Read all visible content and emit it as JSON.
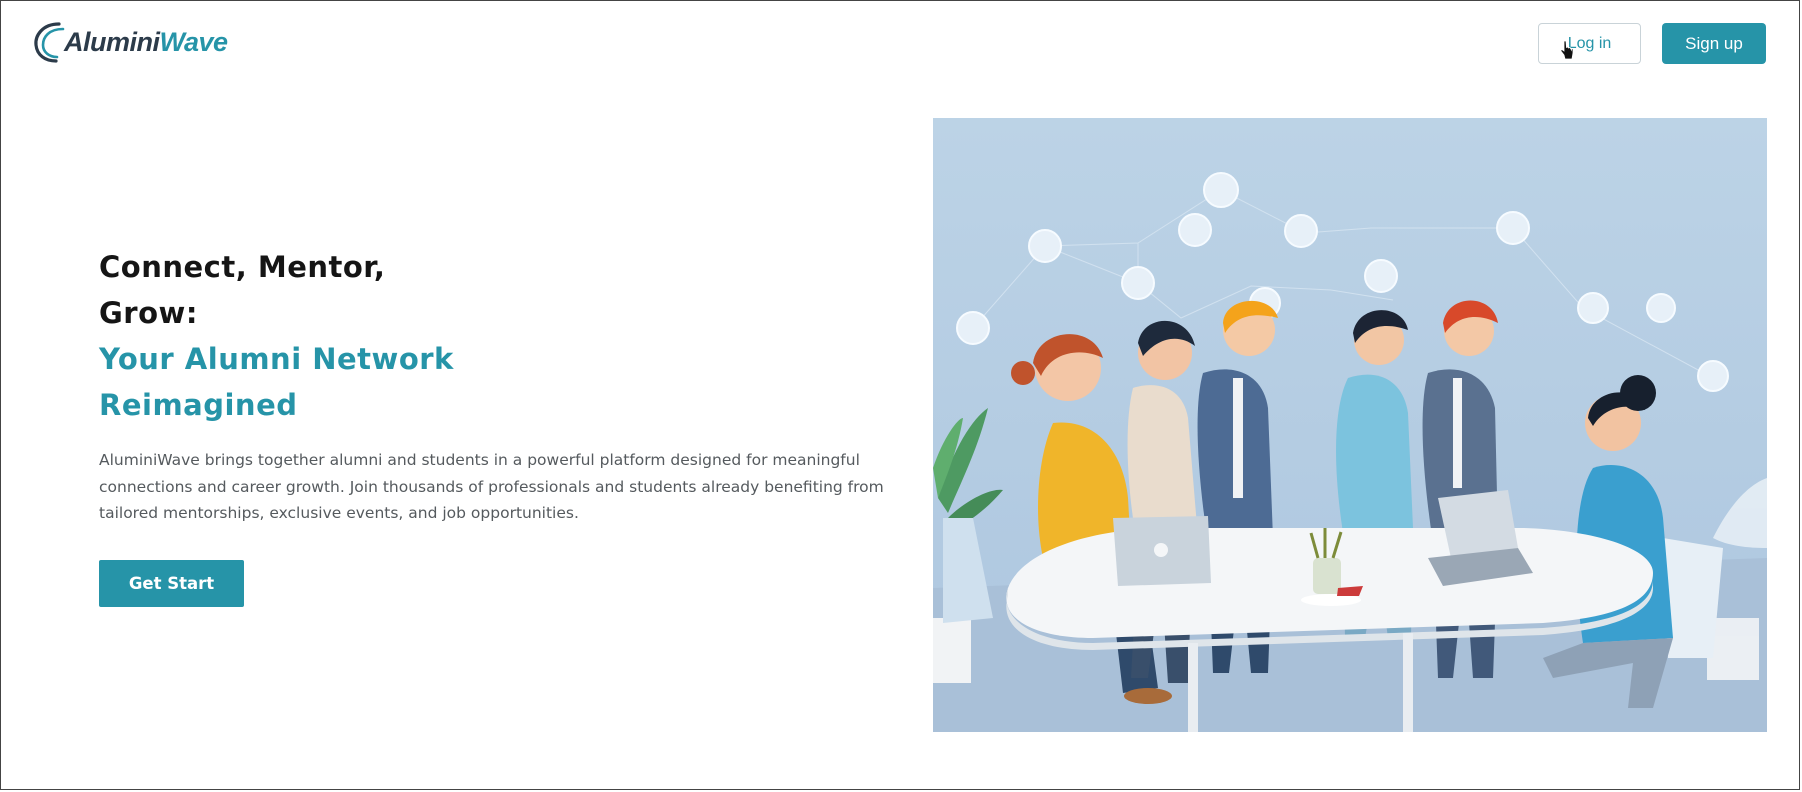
{
  "header": {
    "logo": {
      "part1": "Alumini",
      "part2": "Wave"
    },
    "login_label": "Log in",
    "signup_label": "Sign up"
  },
  "hero": {
    "title_lines": [
      "Connect, Mentor,",
      "Grow:"
    ],
    "accent_lines": [
      "Your Alumni Network",
      "Reimagined"
    ],
    "description": "AluminiWave brings together alumni and students in a powerful platform designed for meaningful connections and career growth. Join thousands of professionals and students already benefiting from tailored mentorships, exclusive events, and job opportunities.",
    "cta_label": "Get Start"
  },
  "colors": {
    "brand": "#2694a8",
    "logo_dark": "#2c3b4a",
    "heading": "#151515",
    "body_text": "#555a5e",
    "image_bg": "#b9d0e3"
  },
  "icons": [
    "logo-wave-icon",
    "mouse-pointer-icon"
  ],
  "illustration": {
    "description_hidden": true
  }
}
